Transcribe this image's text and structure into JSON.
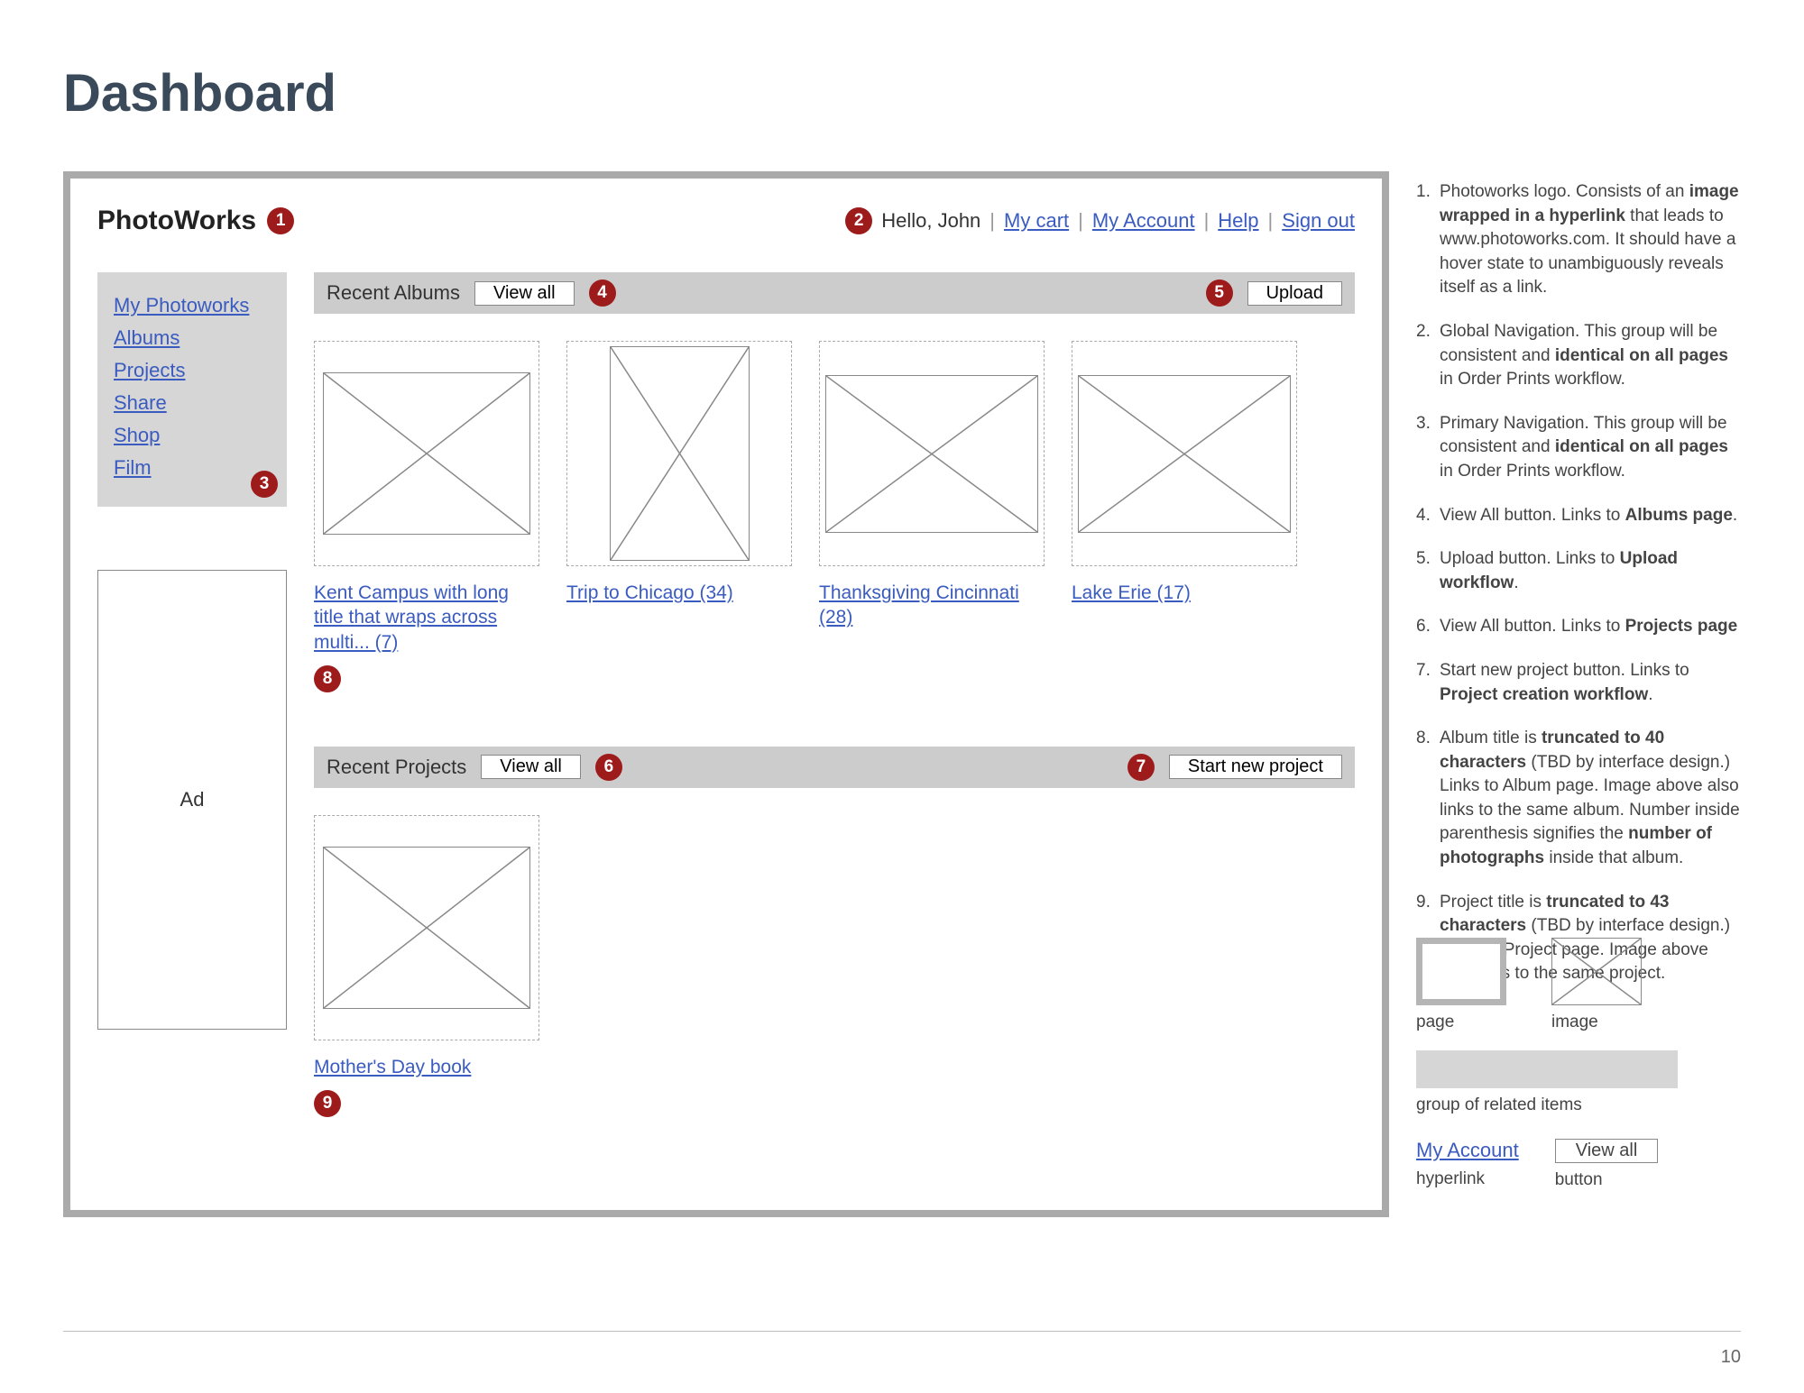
{
  "page_title": "Dashboard",
  "page_number": "10",
  "logo": "PhotoWorks",
  "global_nav": {
    "greeting": "Hello, John",
    "links": [
      "My cart",
      "My Account",
      "Help",
      "Sign out"
    ]
  },
  "primary_nav": [
    "My Photoworks",
    "Albums",
    "Projects",
    "Share",
    "Shop",
    "Film"
  ],
  "ad_label": "Ad",
  "sections": {
    "albums": {
      "title": "Recent Albums",
      "view_all": "View all",
      "upload": "Upload"
    },
    "projects": {
      "title": "Recent Projects",
      "view_all": "View all",
      "start_new": "Start new project"
    }
  },
  "albums": [
    {
      "title": "Kent Campus with long title that wraps across multi... (7)"
    },
    {
      "title": "Trip to Chicago (34)"
    },
    {
      "title": "Thanksgiving Cincinnati (28)"
    },
    {
      "title": "Lake Erie (17)"
    }
  ],
  "projects": [
    {
      "title": "Mother's Day book"
    }
  ],
  "annotations": [
    "Photoworks logo. Consists of an <b>image wrapped in a hyperlink</b> that leads to www.photoworks.com. It should have a hover state to unambiguously reveals itself as a link.",
    "Global Navigation. This group will be consistent and <b>identical on all pages</b> in Order Prints workflow.",
    "Primary Navigation. This group will be consistent and <b>identical on all pages</b> in Order Prints workflow.",
    "View All button. Links to <b>Albums page</b>.",
    "Upload button. Links to <b>Upload workflow</b>.",
    "View All button. Links to <b>Projects page</b>",
    "Start new project button. Links to <b>Project creation workflow</b>.",
    "Album title is <b>truncated to 40 characters</b> (TBD by interface design.) Links to Album page. Image above also links to the same album. Number inside parenthesis signifies the <b>number of photographs</b> inside that album.",
    "Project title is <b>truncated to 43 characters</b> (TBD by interface design.) Links to Project page. Image above also links to the same project."
  ],
  "legend": {
    "page": "page",
    "image": "image",
    "group": "group of related items",
    "hyperlink_example": "My Account",
    "hyperlink": "hyperlink",
    "button_example": "View all",
    "button": "button"
  }
}
